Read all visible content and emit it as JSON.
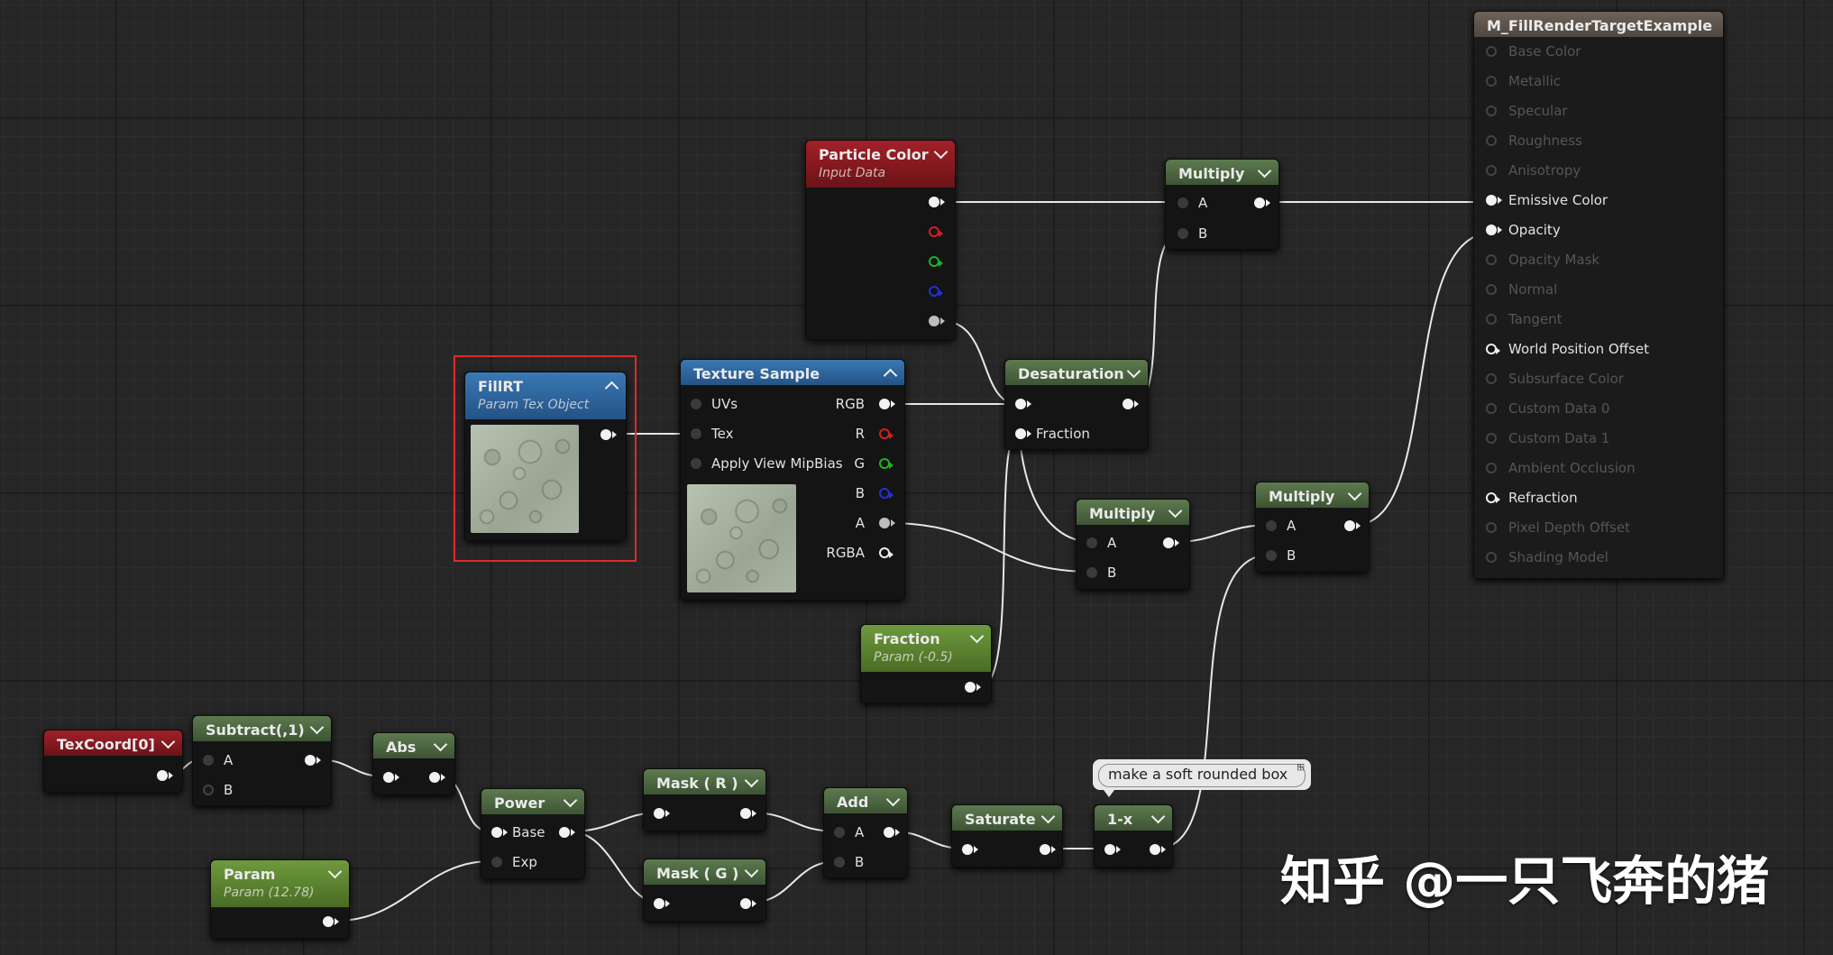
{
  "result_node": {
    "title": "M_FillRenderTargetExample",
    "pins": [
      {
        "label": "Base Color",
        "active": false
      },
      {
        "label": "Metallic",
        "active": false
      },
      {
        "label": "Specular",
        "active": false
      },
      {
        "label": "Roughness",
        "active": false
      },
      {
        "label": "Anisotropy",
        "active": false
      },
      {
        "label": "Emissive Color",
        "active": true
      },
      {
        "label": "Opacity",
        "active": true
      },
      {
        "label": "Opacity Mask",
        "active": false
      },
      {
        "label": "Normal",
        "active": false
      },
      {
        "label": "Tangent",
        "active": false
      },
      {
        "label": "World Position Offset",
        "active": true
      },
      {
        "label": "Subsurface Color",
        "active": false
      },
      {
        "label": "Custom Data 0",
        "active": false
      },
      {
        "label": "Custom Data 1",
        "active": false
      },
      {
        "label": "Ambient Occlusion",
        "active": false
      },
      {
        "label": "Refraction",
        "active": true
      },
      {
        "label": "Pixel Depth Offset",
        "active": false
      },
      {
        "label": "Shading Model",
        "active": false
      }
    ]
  },
  "particle_color": {
    "title": "Particle Color",
    "subtitle": "Input Data"
  },
  "fill_rt": {
    "title": "FillRT",
    "subtitle": "Param Tex Object"
  },
  "texture_sample": {
    "title": "Texture Sample",
    "inputs": [
      "UVs",
      "Tex",
      "Apply View MipBias"
    ],
    "outputs": [
      "RGB",
      "R",
      "G",
      "B",
      "A",
      "RGBA"
    ]
  },
  "desaturation": {
    "title": "Desaturation",
    "fraction_label": "Fraction"
  },
  "multiply_top": {
    "title": "Multiply",
    "a": "A",
    "b": "B"
  },
  "multiply_mid": {
    "title": "Multiply",
    "a": "A",
    "b": "B"
  },
  "multiply_right": {
    "title": "Multiply",
    "a": "A",
    "b": "B"
  },
  "fraction_param": {
    "title": "Fraction",
    "subtitle": "Param (-0.5)"
  },
  "texcoord": {
    "title": "TexCoord[0]"
  },
  "subtract": {
    "title": "Subtract(,1)",
    "a": "A",
    "b": "B"
  },
  "abs": {
    "title": "Abs"
  },
  "power": {
    "title": "Power",
    "base": "Base",
    "exp": "Exp"
  },
  "param": {
    "title": "Param",
    "subtitle": "Param (12.78)"
  },
  "mask_r": {
    "title": "Mask ( R )"
  },
  "mask_g": {
    "title": "Mask ( G )"
  },
  "add": {
    "title": "Add",
    "a": "A",
    "b": "B"
  },
  "saturate": {
    "title": "Saturate"
  },
  "one_minus_x": {
    "title": "1-x"
  },
  "comment": {
    "text": "make a soft rounded box"
  },
  "watermark": {
    "text": "知乎 @一只飞奔的猪"
  }
}
